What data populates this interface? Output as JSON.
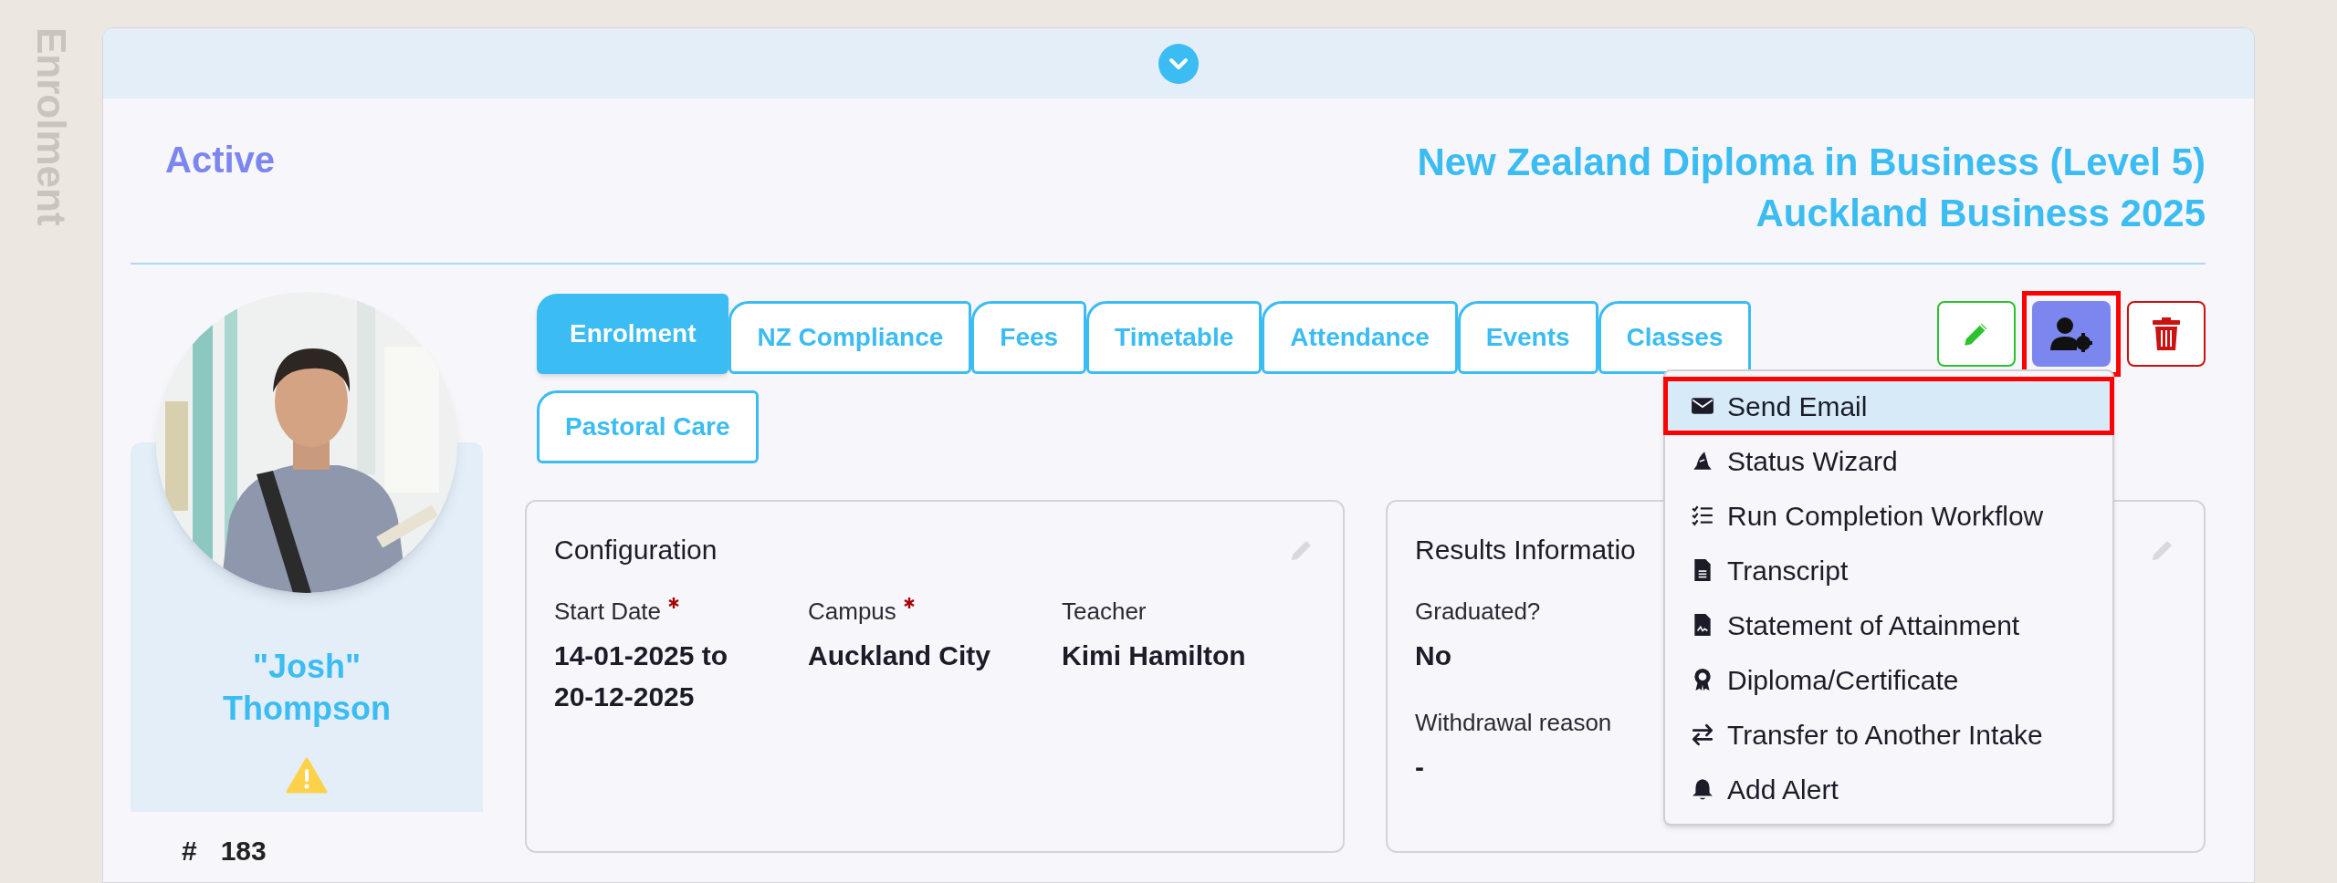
{
  "side_label": "Enrolment",
  "status": "Active",
  "program": {
    "line_1": "New Zealand Diploma in Business (Level 5)",
    "line_2": "Auckland Business 2025"
  },
  "profile": {
    "nickname": "\"Josh\"",
    "surname": "Thompson",
    "id_symbol": "#",
    "id": "183"
  },
  "tabs": [
    {
      "label": "Enrolment",
      "selected": true
    },
    {
      "label": "NZ Compliance",
      "selected": false
    },
    {
      "label": "Fees",
      "selected": false
    },
    {
      "label": "Timetable",
      "selected": false
    },
    {
      "label": "Attendance",
      "selected": false
    },
    {
      "label": "Events",
      "selected": false
    },
    {
      "label": "Classes",
      "selected": false
    },
    {
      "label": "Pastoral Care",
      "selected": false
    }
  ],
  "actions": [
    {
      "kind": "edit",
      "annotated": false
    },
    {
      "kind": "manage",
      "annotated": true
    },
    {
      "kind": "delete",
      "annotated": false
    }
  ],
  "menu": [
    {
      "kind": "email",
      "label": "Send Email",
      "selected": true,
      "annotated": true
    },
    {
      "kind": "wizard",
      "label": "Status Wizard",
      "selected": false,
      "annotated": false
    },
    {
      "kind": "checklist",
      "label": "Run Completion Workflow",
      "selected": false,
      "annotated": false
    },
    {
      "kind": "file",
      "label": "Transcript",
      "selected": false,
      "annotated": false
    },
    {
      "kind": "statement",
      "label": "Statement of Attainment",
      "selected": false,
      "annotated": false
    },
    {
      "kind": "award",
      "label": "Diploma/Certificate",
      "selected": false,
      "annotated": false
    },
    {
      "kind": "transfer",
      "label": "Transfer to Another Intake",
      "selected": false,
      "annotated": false
    },
    {
      "kind": "bell",
      "label": "Add Alert",
      "selected": false,
      "annotated": false
    }
  ],
  "configuration": {
    "title": "Configuration",
    "fields": [
      {
        "label": "Start Date",
        "required": true,
        "value": "14-01-2025 to 20-12-2025"
      },
      {
        "label": "Campus",
        "required": true,
        "value": "Auckland City"
      },
      {
        "label": "Teacher",
        "required": false,
        "value": "Kimi Hamilton"
      }
    ]
  },
  "results": {
    "title": "Results Informatio",
    "fields": [
      {
        "label": "Graduated?",
        "required": false,
        "value": "No"
      },
      {
        "label": "Withdrawal reason",
        "required": false,
        "value": "-"
      }
    ]
  }
}
